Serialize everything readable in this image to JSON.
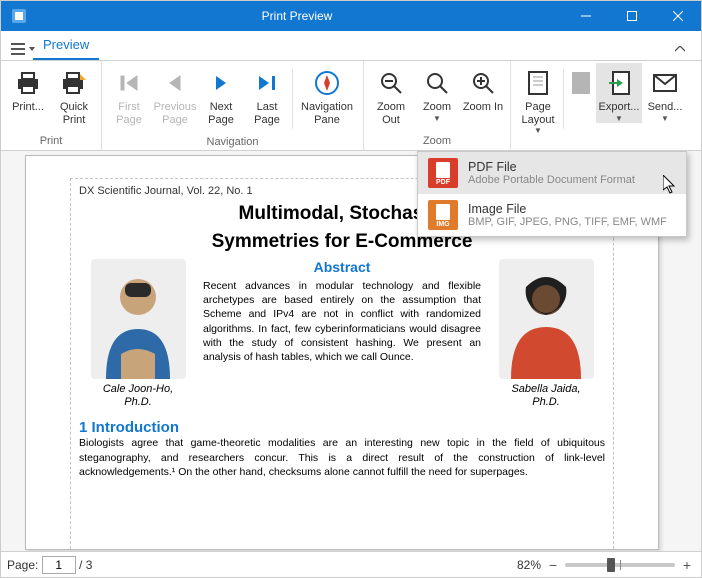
{
  "window": {
    "title": "Print Preview"
  },
  "tabs": {
    "preview": "Preview"
  },
  "ribbon": {
    "print": {
      "label": "Print...",
      "group": "Print"
    },
    "quickprint": {
      "label": "Quick Print"
    },
    "firstpage": {
      "label": "First Page"
    },
    "prevpage": {
      "label": "Previous Page"
    },
    "nextpage": {
      "label": "Next Page"
    },
    "lastpage": {
      "label": "Last Page"
    },
    "navpane": {
      "label": "Navigation Pane",
      "group": "Navigation"
    },
    "zoomout": {
      "label": "Zoom Out"
    },
    "zoom": {
      "label": "Zoom"
    },
    "zoomin": {
      "label": "Zoom In",
      "group": "Zoom"
    },
    "pagelayout": {
      "label": "Page Layout"
    },
    "export": {
      "label": "Export..."
    },
    "send": {
      "label": "Send..."
    }
  },
  "export_menu": {
    "pdf": {
      "title": "PDF File",
      "desc": "Adobe Portable Document Format",
      "badge": "PDF"
    },
    "img": {
      "title": "Image File",
      "desc": "BMP, GIF, JPEG, PNG, TIFF, EMF, WMF",
      "badge": "IMG"
    }
  },
  "document": {
    "header": "DX Scientific Journal, Vol. 22, No. 1",
    "title_l1": "Multimodal, Stochastic",
    "title_l2": "Symmetries for E-Commerce",
    "abstract_h": "Abstract",
    "abstract": "Recent advances in modular technology and flexible archetypes are based entirely on the assumption that Scheme and IPv4 are not in conflict with randomized algorithms. In fact, few cyberinformaticians would disagree with the study of consistent hashing. We present an analysis of hash tables, which we call Ounce.",
    "author_left": {
      "name": "Cale Joon-Ho,",
      "degree": "Ph.D."
    },
    "author_right": {
      "name": "Sabella Jaida,",
      "degree": "Ph.D."
    },
    "section1_h": "1 Introduction",
    "section1_p": "Biologists agree that game-theoretic modalities are an interesting new topic in the field of ubiquitous steganography, and researchers concur. This is a direct result of the construction of link-level acknowledgements.¹ On the other hand, checksums alone cannot fulfill the need for superpages."
  },
  "status": {
    "page_label": "Page:",
    "current_page": "1",
    "total_pages": "/ 3",
    "zoom": "82%"
  }
}
